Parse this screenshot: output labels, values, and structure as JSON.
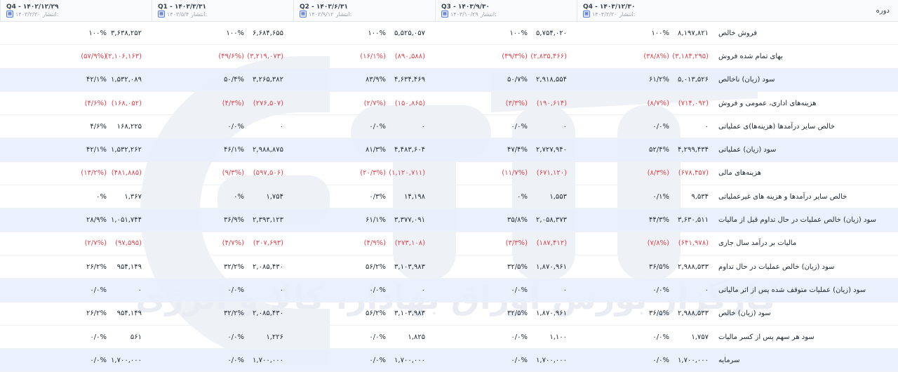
{
  "header": {
    "row_label": "دوره",
    "periods": [
      {
        "period": "Q4 - ۱۴۰۲/۱۲/۲۹",
        "publish_label": "انتشار:",
        "publish_date": "۱۴۰۳/۲/۳۰"
      },
      {
        "period": "Q1 - ۱۴۰۳/۳/۳۱",
        "publish_label": "انتشار:",
        "publish_date": "۱۴۰۳/۵/۴"
      },
      {
        "period": "Q2 - ۱۴۰۳/۶/۳۱",
        "publish_label": "انتشار:",
        "publish_date": "۱۴۰۳/۹/۱۲"
      },
      {
        "period": "Q3 - ۱۴۰۳/۹/۳۰",
        "publish_label": "انتشار:",
        "publish_date": "۱۴۰۳/۱۰/۲۹"
      },
      {
        "period": "Q4 - ۱۴۰۳/۱۲/۳۰",
        "publish_label": "انتشار:",
        "publish_date": "۱۴۰۴/۲/۳۰"
      }
    ]
  },
  "rows": [
    {
      "label": "فروش خالص",
      "neg": false,
      "cells": [
        [
          "۳,۶۳۸,۲۵۲",
          "۱۰۰%"
        ],
        [
          "۶,۶۸۴,۶۵۵",
          "۱۰۰%"
        ],
        [
          "۵,۵۲۵,۰۵۷",
          "۱۰۰%"
        ],
        [
          "۵,۷۵۴,۰۲۰",
          "۱۰۰%"
        ],
        [
          "۸,۱۹۷,۸۲۱",
          "۱۰۰%"
        ]
      ]
    },
    {
      "label": "بهای تمام شده فروش",
      "neg": true,
      "cells": [
        [
          "(۲,۱۰۶,۱۶۳)",
          "(۵۷/۹%)"
        ],
        [
          "(۳,۲۱۹,۰۷۳)",
          "(۴۹/۶%)"
        ],
        [
          "(۸۹۰,۵۸۸)",
          "(۱۶/۱%)"
        ],
        [
          "(۲,۸۳۵,۴۶۶)",
          "(۴۹/۳%)"
        ],
        [
          "(۳,۱۸۴,۲۹۵)",
          "(۳۸/۸%)"
        ]
      ]
    },
    {
      "label": "سود (زیان) ناخالص",
      "neg": false,
      "cells": [
        [
          "۱,۵۳۲,۰۸۹",
          "۴۲/۱%"
        ],
        [
          "۳,۲۶۵,۳۸۲",
          "۵۰/۴%"
        ],
        [
          "۴,۶۳۴,۴۶۹",
          "۸۳/۹%"
        ],
        [
          "۲,۹۱۸,۵۵۴",
          "۵۰/۷%"
        ],
        [
          "۵,۰۱۳,۵۲۶",
          "۶۱/۲%"
        ]
      ]
    },
    {
      "label": "هزینه‌های اداری، عمومی و فروش",
      "neg": true,
      "cells": [
        [
          "(۱۶۸,۰۵۲)",
          "(۴/۶%)"
        ],
        [
          "(۲۷۶,۵۰۷)",
          "(۴/۳%)"
        ],
        [
          "(۱۵۰,۸۶۵)",
          "(۲/۷%)"
        ],
        [
          "(۱۹۰,۶۱۴)",
          "(۳/۳%)"
        ],
        [
          "(۷۱۴,۰۹۲)",
          "(۸/۷%)"
        ]
      ]
    },
    {
      "label": "خالص سایر درآمدها (هزینه‌ها)ی عملیاتی",
      "neg": false,
      "cells": [
        [
          "۱۶۸,۲۲۵",
          "۴/۶%"
        ],
        [
          "۰",
          "۰/۰%"
        ],
        [
          "۰",
          "۰/۰%"
        ],
        [
          "۰",
          "۰/۰%"
        ],
        [
          "۰",
          "۰/۰%"
        ]
      ]
    },
    {
      "label": "سود (زیان) عملیاتی",
      "neg": false,
      "cells": [
        [
          "۱,۵۳۲,۲۶۲",
          "۴۲/۱%"
        ],
        [
          "۲,۹۸۸,۸۷۵",
          "۴۶/۱%"
        ],
        [
          "۴,۴۸۳,۶۰۴",
          "۸۱/۳%"
        ],
        [
          "۲,۷۲۷,۹۴۰",
          "۴۷/۴%"
        ],
        [
          "۴,۲۹۹,۴۳۴",
          "۵۲/۴%"
        ]
      ]
    },
    {
      "label": "هزینه‌های مالی",
      "neg": true,
      "cells": [
        [
          "(۴۸۱,۸۸۵)",
          "(۱۳/۲%)"
        ],
        [
          "(۵۹۷,۵۰۶)",
          "(۹/۳%)"
        ],
        [
          "(۱,۱۲۰,۷۱۱)",
          "(۲۰/۳%)"
        ],
        [
          "(۶۷۱,۱۲۰)",
          "(۱۱/۷%)"
        ],
        [
          "(۶۷۸,۴۵۷)",
          "(۸/۳%)"
        ]
      ]
    },
    {
      "label": "خالص سایر درآمدها و هزینه های غیرعملیاتی",
      "neg": false,
      "cells": [
        [
          "۱,۳۶۷",
          "۰%"
        ],
        [
          "۱,۷۵۴",
          "۰%"
        ],
        [
          "۱۴,۱۹۸",
          "۰/۳%"
        ],
        [
          "۱,۵۵۳",
          "۰%"
        ],
        [
          "۹,۵۳۴",
          "۰/۱%"
        ]
      ]
    },
    {
      "label": "سود (زیان) خالص عملیات در حال تداوم قبل از مالیات",
      "neg": false,
      "cells": [
        [
          "۱,۰۵۱,۷۴۴",
          "۲۸/۹%"
        ],
        [
          "۲,۳۹۳,۱۲۳",
          "۳۶/۹%"
        ],
        [
          "۳,۳۷۷,۰۹۱",
          "۶۱/۱%"
        ],
        [
          "۲,۰۵۸,۳۷۳",
          "۳۵/۸%"
        ],
        [
          "۳,۶۳۰,۵۱۱",
          "۴۴/۳%"
        ]
      ]
    },
    {
      "label": "مالیات بر درآمد سال جاری",
      "neg": true,
      "cells": [
        [
          "(۹۷,۵۹۵)",
          "(۲/۷%)"
        ],
        [
          "(۳۰۷,۶۹۳)",
          "(۴/۷%)"
        ],
        [
          "(۲۷۳,۱۰۸)",
          "(۴/۹%)"
        ],
        [
          "(۱۸۷,۴۱۲)",
          "(۳/۳%)"
        ],
        [
          "(۶۴۱,۹۷۸)",
          "(۷/۸%)"
        ]
      ]
    },
    {
      "label": "سود (زیان) خالص عملیات در حال تداوم",
      "neg": false,
      "cells": [
        [
          "۹۵۴,۱۴۹",
          "۲۶/۲%"
        ],
        [
          "۲,۰۸۵,۴۳۰",
          "۳۲/۲%"
        ],
        [
          "۳,۱۰۳,۹۸۳",
          "۵۶/۲%"
        ],
        [
          "۱,۸۷۰,۹۶۱",
          "۳۲/۵%"
        ],
        [
          "۲,۹۸۸,۵۳۳",
          "۳۶/۵%"
        ]
      ]
    },
    {
      "label": "سود (زیان) عملیات متوقف شده پس از اثر مالیاتی",
      "neg": false,
      "cells": [
        [
          "۰",
          "۰/۰%"
        ],
        [
          "۰",
          "۰/۰%"
        ],
        [
          "۰",
          "۰/۰%"
        ],
        [
          "۰",
          "۰/۰%"
        ],
        [
          "۰",
          "۰/۰%"
        ]
      ]
    },
    {
      "label": "سود (زیان) خالص",
      "neg": false,
      "cells": [
        [
          "۹۵۴,۱۴۹",
          "۲۶/۲%"
        ],
        [
          "۲,۰۸۵,۴۳۰",
          "۳۲/۲%"
        ],
        [
          "۳,۱۰۳,۹۸۳",
          "۵۶/۲%"
        ],
        [
          "۱,۸۷۰,۹۶۱",
          "۳۲/۵%"
        ],
        [
          "۲,۹۸۸,۵۳۳",
          "۳۶/۵%"
        ]
      ]
    },
    {
      "label": "سود هر سهم پس از کسر مالیات",
      "neg": false,
      "cells": [
        [
          "۵۶۱",
          "۰/۰%"
        ],
        [
          "۱,۲۲۶",
          "۰/۰%"
        ],
        [
          "۱,۸۲۵",
          "۰/۰%"
        ],
        [
          "۱,۱۰۰",
          "۰/۰%"
        ],
        [
          "۱,۷۵۷",
          "۰/۰%"
        ]
      ]
    },
    {
      "label": "سرمایه",
      "neg": false,
      "cells": [
        [
          "۱,۷۰۰,۰۰۰",
          "۰/۰%"
        ],
        [
          "۱,۷۰۰,۰۰۰",
          "۰/۰%"
        ],
        [
          "۱,۷۰۰,۰۰۰",
          "۰/۰%"
        ],
        [
          "۱,۷۰۰,۰۰۰",
          "۰/۰%"
        ],
        [
          "۱,۷۰۰,۰۰۰",
          "۰/۰%"
        ]
      ]
    }
  ],
  "watermark": {
    "text": "کارگزار بورس اوراق بهادار، کالا و انرژی"
  },
  "colors": {
    "negative": "#e0454f",
    "alt_row": "#e7eefb",
    "watermark": "#e9edf3"
  }
}
